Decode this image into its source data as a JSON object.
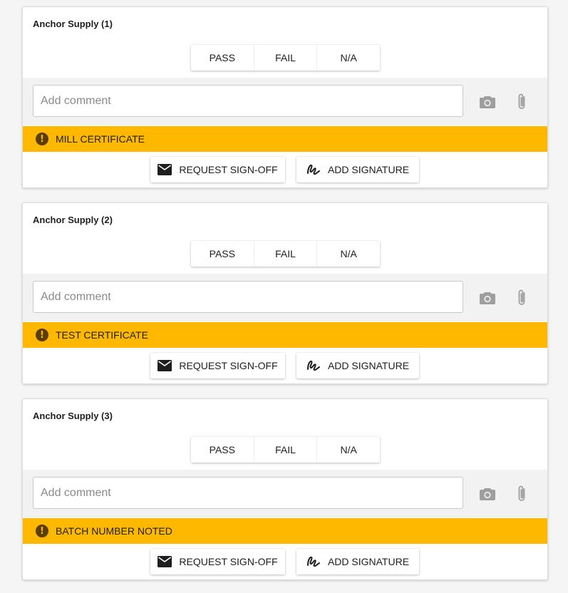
{
  "cards": [
    {
      "title": "Anchor Supply (1)",
      "options": [
        "PASS",
        "FAIL",
        "N/A"
      ],
      "comment_placeholder": "Add comment",
      "warning": "MILL CERTIFICATE",
      "request_label": "REQUEST SIGN-OFF",
      "signature_label": "ADD SIGNATURE"
    },
    {
      "title": "Anchor Supply (2)",
      "options": [
        "PASS",
        "FAIL",
        "N/A"
      ],
      "comment_placeholder": "Add comment",
      "warning": "TEST CERTIFICATE",
      "request_label": "REQUEST SIGN-OFF",
      "signature_label": "ADD SIGNATURE"
    },
    {
      "title": "Anchor Supply (3)",
      "options": [
        "PASS",
        "FAIL",
        "N/A"
      ],
      "comment_placeholder": "Add comment",
      "warning": "BATCH NUMBER NOTED",
      "request_label": "REQUEST SIGN-OFF",
      "signature_label": "ADD SIGNATURE"
    }
  ],
  "icons": {
    "camera": "camera-icon",
    "attach": "paperclip-icon",
    "warning": "warning-icon",
    "request": "envelope-icon",
    "signature": "signature-icon"
  },
  "colors": {
    "warning_bar": "#ffb800",
    "comment_row": "#f2f2f2",
    "icon_gray": "#9e9e9e"
  }
}
